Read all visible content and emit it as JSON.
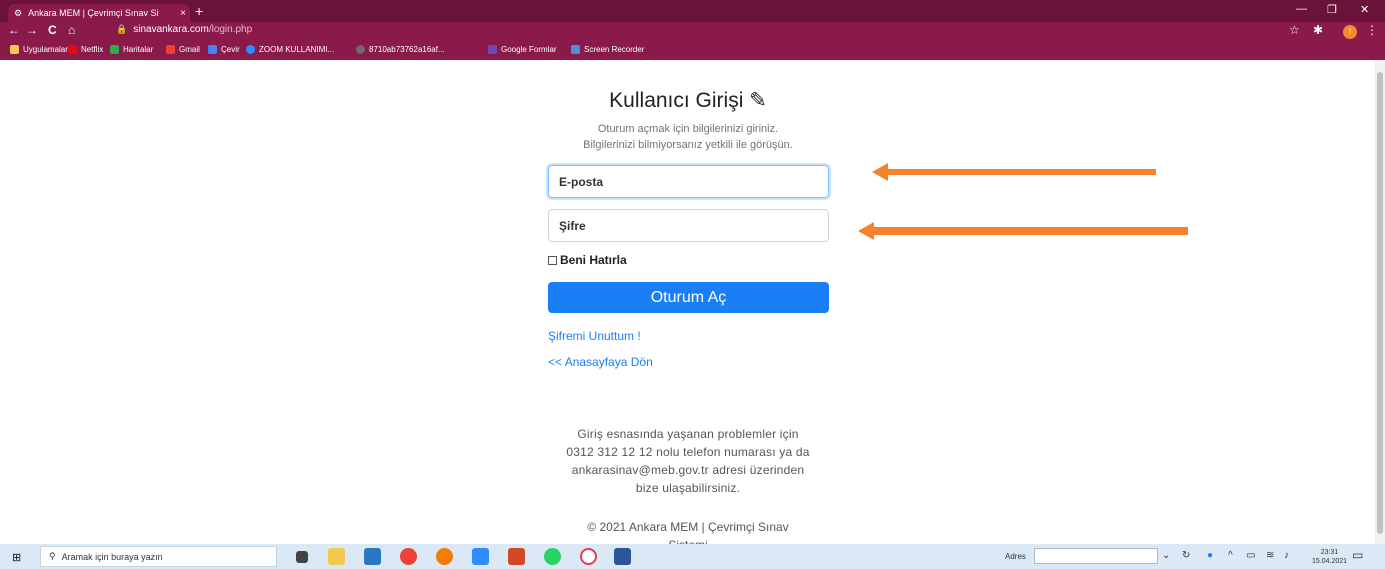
{
  "browser": {
    "tab_title": "Ankara MEM | Çevrimçi Sınav Si",
    "tab_close": "×",
    "new_tab": "+",
    "url_host": "sinavankara.com",
    "url_path": "/login.php",
    "window_controls": {
      "minimize": "—",
      "maximize": "❐",
      "close": "✕"
    },
    "nav": {
      "back": "←",
      "forward": "→",
      "reload": "C",
      "home": "⌂"
    },
    "bookmarks": [
      {
        "label": "Uygulamalar",
        "color": "#f2c94c"
      },
      {
        "label": "Netflix",
        "color": "#e50914"
      },
      {
        "label": "Haritalar",
        "color": "#34a853"
      },
      {
        "label": "Gmail",
        "color": "#ea4335"
      },
      {
        "label": "Çevir",
        "color": "#4285f4"
      },
      {
        "label": "ZOOM KULLANIMI...",
        "color": "#2d8cff"
      },
      {
        "label": "8710ab73762a16af...",
        "color": "#6b6b6b"
      },
      {
        "label": "Google Formlar",
        "color": "#7248b9"
      },
      {
        "label": "Screen Recorder",
        "color": "#4a90d9"
      }
    ],
    "extension_badge": "!"
  },
  "login": {
    "title": "Kullanıcı Girişi",
    "title_icon": "✎",
    "subtitle_line1": "Oturum açmak için bilgilerinizi giriniz.",
    "subtitle_line2": "Bilgilerinizi bilmiyorsanız yetkili ile görüşün.",
    "email_placeholder": "E-posta",
    "password_placeholder": "Şifre",
    "remember_label": "Beni Hatırla",
    "submit_label": "Oturum Aç",
    "forgot_link": "Şifremi Unuttum !",
    "home_link": "<< Anasayfaya Dön",
    "info_lines": [
      "Giriş esnasında yaşanan problemler için",
      "0312 312 12 12 nolu telefon numarası ya da",
      "ankarasinav@meb.gov.tr adresi üzerinden",
      "bize ulaşabilirsiniz."
    ],
    "footer_line1": "© 2021 Ankara MEM | Çevrimçi Sınav",
    "footer_line2": "Sistemi"
  },
  "taskbar": {
    "search_placeholder": "Aramak için buraya yazın",
    "address_label": "Adres",
    "time": "23:31",
    "date": "15.04.2021"
  },
  "colors": {
    "accent": "#1a7ef6",
    "browser_frame": "#8a1a4a",
    "annotation_arrow": "#f5822a"
  }
}
